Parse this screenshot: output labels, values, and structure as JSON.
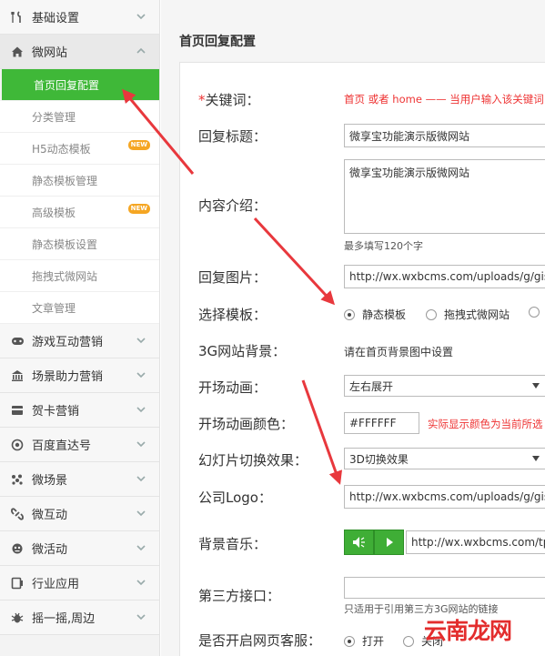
{
  "sidebar": {
    "groups": [
      {
        "label": "基础设置",
        "icon": "tools-icon",
        "state": "collapsed"
      },
      {
        "label": "微网站",
        "icon": "home-icon",
        "state": "expanded"
      }
    ],
    "sub_items": [
      {
        "label": "首页回复配置",
        "active": true,
        "new": false
      },
      {
        "label": "分类管理",
        "active": false,
        "new": false
      },
      {
        "label": "H5动态模板",
        "active": false,
        "new": true
      },
      {
        "label": "静态模板管理",
        "active": false,
        "new": false
      },
      {
        "label": "高级模板",
        "active": false,
        "new": true
      },
      {
        "label": "静态模板设置",
        "active": false,
        "new": false
      },
      {
        "label": "拖拽式微网站",
        "active": false,
        "new": false
      },
      {
        "label": "文章管理",
        "active": false,
        "new": false
      }
    ],
    "more_groups": [
      {
        "label": "游戏互动营销",
        "icon": "gamepad-icon"
      },
      {
        "label": "场景助力营销",
        "icon": "bank-icon"
      },
      {
        "label": "贺卡营销",
        "icon": "card-icon"
      },
      {
        "label": "百度直达号",
        "icon": "target-icon"
      },
      {
        "label": "微场景",
        "icon": "cluster-icon"
      },
      {
        "label": "微互动",
        "icon": "link-icon"
      },
      {
        "label": "微活动",
        "icon": "mascot-icon"
      },
      {
        "label": "行业应用",
        "icon": "app-icon"
      },
      {
        "label": "摇一摇,周边",
        "icon": "bug-icon"
      }
    ],
    "badge_new": "NEW"
  },
  "main": {
    "title": "首页回复配置",
    "form": {
      "keyword": {
        "required_mark": "*",
        "label": "关键词：",
        "hint": "首页 或者 home —— 当用户输入该关键词"
      },
      "reply_title": {
        "label": "回复标题：",
        "value": "微享宝功能演示版微网站"
      },
      "content_intro": {
        "label": "内容介绍：",
        "value": "微享宝功能演示版微网站",
        "hint": "最多填写120个字"
      },
      "reply_image": {
        "label": "回复图片：",
        "value": "http://wx.wxbcms.com/uploads/g/gisw"
      },
      "template": {
        "label": "选择模板：",
        "options": [
          "静态模板",
          "拖拽式微网站"
        ],
        "selected": "静态模板"
      },
      "bg_3g": {
        "label": "3G网站背景：",
        "text": "请在首页背景图中设置"
      },
      "opening_anim": {
        "label": "开场动画：",
        "value": "左右展开"
      },
      "opening_color": {
        "label": "开场动画颜色：",
        "value": "#FFFFFF",
        "hint": "实际显示颜色为当前所选"
      },
      "slide_effect": {
        "label": "幻灯片切换效果：",
        "value": "3D切换效果"
      },
      "company_logo": {
        "label": "公司Logo：",
        "value": "http://wx.wxbcms.com/uploads/g/gisw"
      },
      "bg_music": {
        "label": "背景音乐：",
        "value": "http://wx.wxbcms.com/tpl"
      },
      "third_party": {
        "label": "第三方接口：",
        "value": "",
        "hint": "只适用于引用第三方3G网站的链接"
      },
      "customer_service": {
        "label": "是否开启网页客服：",
        "options": [
          "打开",
          "关闭"
        ],
        "selected": "打开"
      }
    }
  },
  "watermark": {
    "text": "云南龙网"
  },
  "colors": {
    "accent_green": "#3fb838",
    "hint_red": "#e33333",
    "arrow_red": "#e8383d"
  }
}
